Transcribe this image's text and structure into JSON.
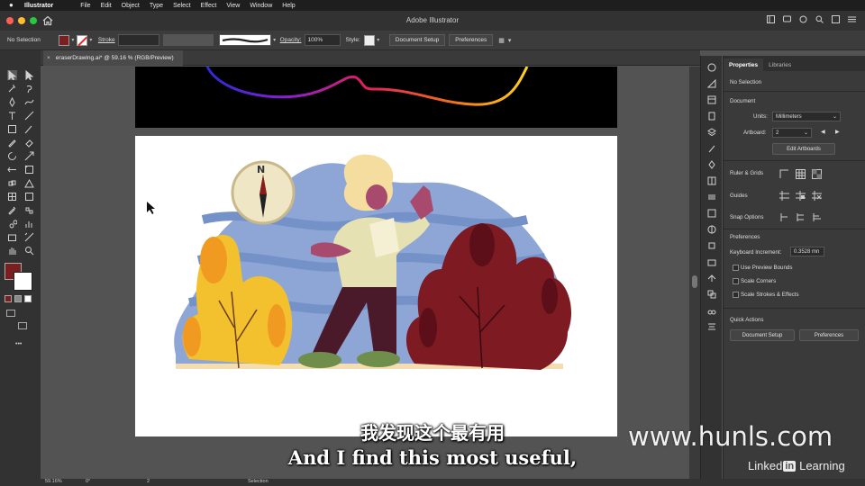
{
  "menubar": {
    "app_name": "Illustrator",
    "items": [
      "File",
      "Edit",
      "Object",
      "Type",
      "Select",
      "Effect",
      "View",
      "Window",
      "Help"
    ]
  },
  "titlebar": {
    "title": "Adobe Illustrator"
  },
  "controlbar": {
    "selection": "No Selection",
    "stroke_label": "Stroke",
    "opacity_label": "Opacity:",
    "opacity_value": "100%",
    "style_label": "Style:",
    "document_setup": "Document Setup",
    "preferences": "Preferences"
  },
  "document": {
    "tab_close": "×",
    "tab_title": "eraserDrawing.ai* @ 59.16 % (RGB/Preview)"
  },
  "status": {
    "zoom": "59.16%",
    "rotation": "0°",
    "artboard": "2",
    "tool": "Selection"
  },
  "properties": {
    "tabs": [
      "Properties",
      "Libraries"
    ],
    "selection": "No Selection",
    "document_header": "Document",
    "units_label": "Units:",
    "units_value": "Millimeters",
    "artboard_label": "Artboard:",
    "artboard_value": "2",
    "edit_artboards": "Edit Artboards",
    "ruler_grids": "Ruler & Grids",
    "guides": "Guides",
    "snap_options": "Snap Options",
    "preferences_header": "Preferences",
    "keyboard_increment_label": "Keyboard Increment:",
    "keyboard_increment_value": "0.3528 mn",
    "use_preview_bounds": "Use Preview Bounds",
    "scale_corners": "Scale Corners",
    "scale_strokes": "Scale Strokes & Effects",
    "quick_actions": "Quick Actions",
    "document_setup": "Document Setup",
    "preferences": "Preferences"
  },
  "subtitles": {
    "chinese": "我发现这个最有用",
    "english": "And I find this most useful,"
  },
  "watermark": {
    "site": "www.hunls.com",
    "brand_left": "Linked",
    "brand_in": "in",
    "brand_right": "Learning"
  },
  "colors": {
    "fill": "#7a1f1f",
    "accent_bush_red": "#7d1a22",
    "accent_bush_yellow": "#f3c12e",
    "sky_blue": "#8aa3d4"
  }
}
